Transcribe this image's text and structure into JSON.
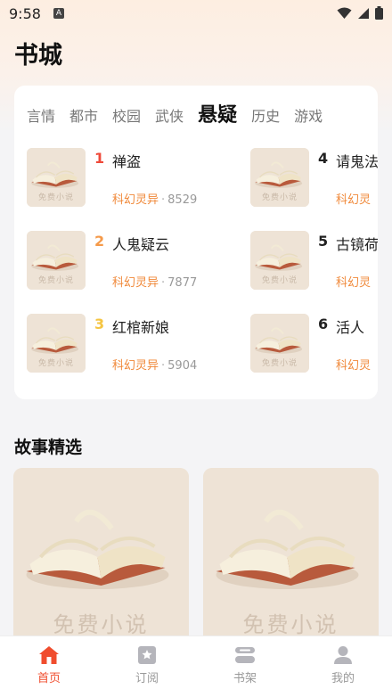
{
  "status_bar": {
    "time": "9:58",
    "notification_icon": "a-badge-icon",
    "icons": [
      "wifi-icon",
      "signal-icon",
      "battery-icon"
    ]
  },
  "page_title": "书城",
  "category_tabs": [
    {
      "label": "言情",
      "active": false
    },
    {
      "label": "都市",
      "active": false
    },
    {
      "label": "校园",
      "active": false
    },
    {
      "label": "武侠",
      "active": false
    },
    {
      "label": "悬疑",
      "active": true
    },
    {
      "label": "历史",
      "active": false
    },
    {
      "label": "游戏",
      "active": false
    }
  ],
  "rank_books": [
    {
      "rank": "1",
      "title": "禅盗",
      "category": "科幻灵异",
      "sep": "·",
      "count": "8529",
      "rank_color": "#ef4a3a"
    },
    {
      "rank": "2",
      "title": "人鬼疑云",
      "category": "科幻灵异",
      "sep": "·",
      "count": "7877",
      "rank_color": "#f59a4a"
    },
    {
      "rank": "3",
      "title": "红棺新娘",
      "category": "科幻灵异",
      "sep": "·",
      "count": "5904",
      "rank_color": "#f5c542"
    },
    {
      "rank": "4",
      "title": "请鬼法",
      "category": "科幻灵",
      "sep": "",
      "count": "",
      "rank_color": "#222222"
    },
    {
      "rank": "5",
      "title": "古镜荷",
      "category": "科幻灵",
      "sep": "",
      "count": "",
      "rank_color": "#222222"
    },
    {
      "rank": "6",
      "title": "活人",
      "category": "科幻灵",
      "sep": "",
      "count": "",
      "rank_color": "#222222"
    }
  ],
  "cover_watermark": "免费小说",
  "section_title": "故事精选",
  "stories": [
    {
      "watermark": "免费小说"
    },
    {
      "watermark": "免费小说"
    }
  ],
  "bottom_nav": [
    {
      "label": "首页",
      "icon": "home-icon",
      "active": true
    },
    {
      "label": "订阅",
      "icon": "bookmark-icon",
      "active": false
    },
    {
      "label": "书架",
      "icon": "bookshelf-icon",
      "active": false
    },
    {
      "label": "我的",
      "icon": "profile-icon",
      "active": false
    }
  ],
  "colors": {
    "accent": "#f04d2e",
    "category": "#f0893a",
    "inactive": "#b5b5bb"
  }
}
